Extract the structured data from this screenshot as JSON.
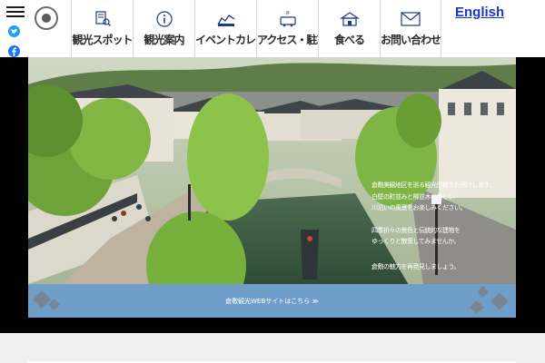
{
  "nav": {
    "items": [
      {
        "label": "観光スポット",
        "icon": "document-search-icon"
      },
      {
        "label": "観光案内",
        "icon": "info-icon"
      },
      {
        "label": "イベントカレンダー",
        "icon": "calendar-icon"
      },
      {
        "label": "アクセス・駐車場",
        "icon": "bus-parking-icon"
      },
      {
        "label": "食べる",
        "icon": "shop-icon"
      },
      {
        "label": "お問い合わせ",
        "icon": "mail-icon"
      }
    ],
    "language_link": "English"
  },
  "hero": {
    "lines": [
      "倉敷美観地区を巡る観光情報をお届けします。",
      "白壁の町並みと柳並木の美しい",
      "川沿いの風景をお楽しみください。",
      "四季折々の景色と伝統的な建物を",
      "ゆっくりと散策してみませんか。",
      "倉敷の魅力を再発見しましょう。"
    ],
    "banner_text": "倉敷観光WEBサイトはこちら ≫"
  },
  "colors": {
    "banner": "#6f9ec9",
    "link": "#1a37c8"
  }
}
